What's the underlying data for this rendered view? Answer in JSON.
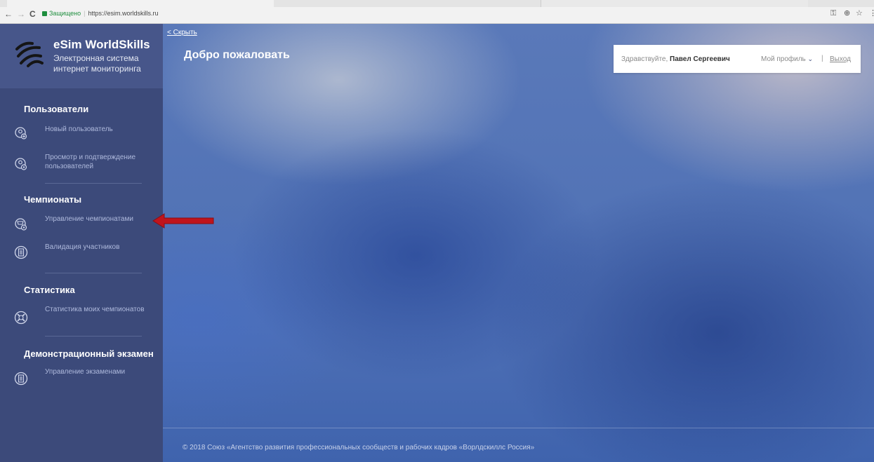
{
  "browser": {
    "secure_label": "Защищено",
    "url": "https://esim.worldskills.ru",
    "back_glyph": "←",
    "forward_glyph": "→",
    "reload_glyph": "C",
    "right_icons": [
      "key-icon",
      "zoom-icon",
      "star-icon",
      "menu-icon"
    ]
  },
  "brand": {
    "title": "eSim WorldSkills",
    "subtitle_line1": "Электронная система",
    "subtitle_line2": "интернет мониторинга"
  },
  "sidebar": {
    "sections": [
      {
        "title": "Пользователи",
        "items": [
          {
            "label": "Новый пользователь",
            "icon": "user-add-icon"
          },
          {
            "label_line1": "Просмотр и подтверждение",
            "label_line2": "пользователей",
            "icon": "user-settings-icon"
          }
        ]
      },
      {
        "title": "Чемпионаты",
        "items": [
          {
            "label": "Управление чемпионатами",
            "icon": "trophy-settings-icon"
          },
          {
            "label": "Валидация участников",
            "icon": "document-icon"
          }
        ]
      },
      {
        "title": "Статистика",
        "items": [
          {
            "label": "Статистика моих чемпионатов",
            "icon": "stats-cross-icon"
          }
        ]
      },
      {
        "title": "Демонстрационный экзамен",
        "items": [
          {
            "label": "Управление экзаменами",
            "icon": "document-icon"
          }
        ]
      }
    ]
  },
  "main": {
    "hide_link": "Скрыть",
    "title": "Добро пожаловать",
    "greeting": "Здравствуйте,",
    "user_name": "Павел Сергеевич",
    "profile_label": "Мой профиль",
    "separator": "|",
    "logout_label": "Выход",
    "footer": "© 2018 Союз «Агентство развития профессиональных сообществ и рабочих кадров «Ворлдскиллс Россия»"
  },
  "colors": {
    "sidebar_bg": "#3c4a7a",
    "brand_bg": "#47568a",
    "arrow": "#c0141c",
    "link_text": "#aeb9dc"
  }
}
